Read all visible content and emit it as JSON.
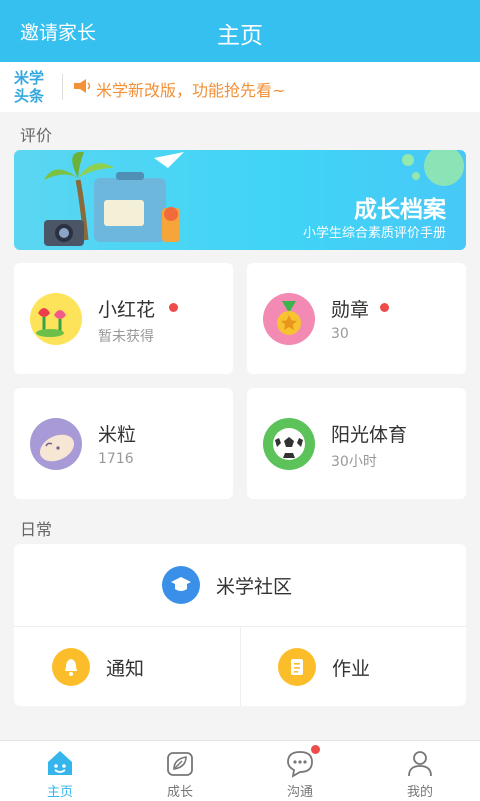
{
  "header": {
    "invite_label": "邀请家长",
    "title": "主页"
  },
  "news": {
    "logo_line1": "米学",
    "logo_line2": "头条",
    "text": "米学新改版，功能抢先看~"
  },
  "sections": {
    "evaluate": "评价",
    "daily": "日常"
  },
  "banner": {
    "title": "成长档案",
    "subtitle": "小学生综合素质评价手册"
  },
  "cards": [
    {
      "name": "小红花",
      "sub": "暂未获得",
      "badge": true
    },
    {
      "name": "勋章",
      "sub": "30",
      "badge": true
    },
    {
      "name": "米粒",
      "sub": "1716",
      "badge": false
    },
    {
      "name": "阳光体育",
      "sub": "30小时",
      "badge": false
    }
  ],
  "daily": {
    "community": "米学社区",
    "notice": "通知",
    "homework": "作业"
  },
  "tabs": [
    {
      "label": "主页",
      "active": true
    },
    {
      "label": "成长",
      "active": false
    },
    {
      "label": "沟通",
      "active": false,
      "badge": true
    },
    {
      "label": "我的",
      "active": false
    }
  ],
  "colors": {
    "primary": "#35c0f0",
    "badge": "#f04b4b",
    "news_text": "#f39038"
  }
}
